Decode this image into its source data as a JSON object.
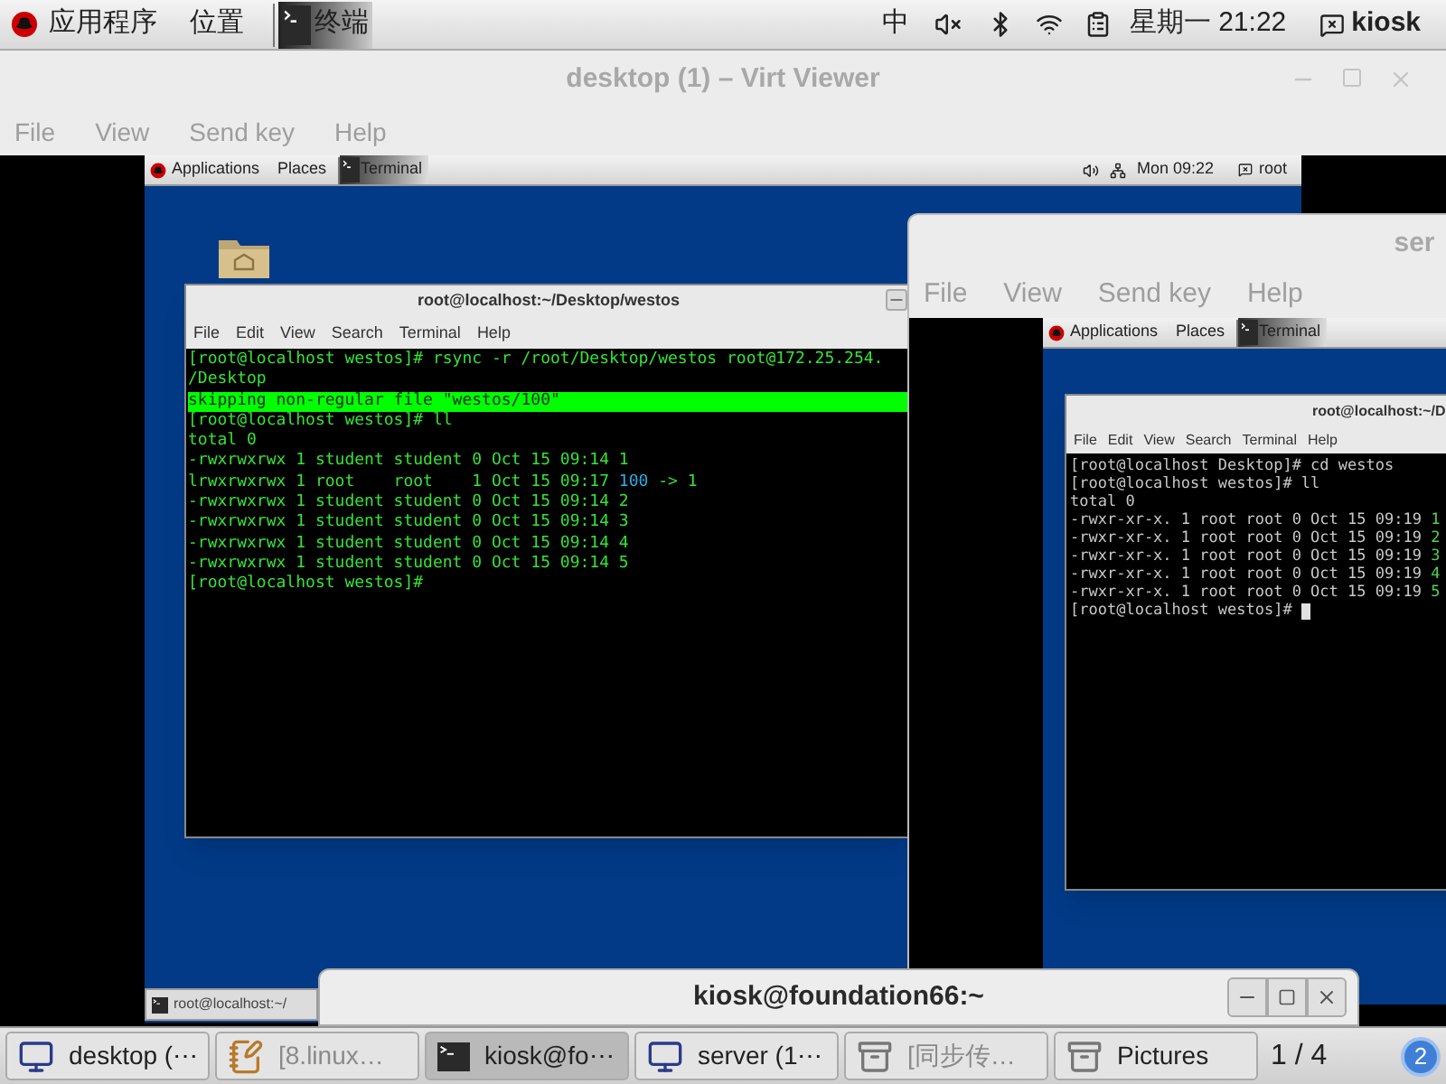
{
  "top_panel": {
    "menus": [
      "应用程序",
      "位置"
    ],
    "task": "终端",
    "input_method": "中",
    "clock": "星期一 21:22",
    "user": "kiosk"
  },
  "viewers": [
    {
      "title": "desktop (1) – Virt Viewer",
      "menus": [
        "File",
        "View",
        "Send key",
        "Help"
      ],
      "guest": {
        "panel": {
          "menus": [
            "Applications",
            "Places"
          ],
          "task": "Terminal",
          "clock": "Mon 09:22",
          "user": "root"
        },
        "home_folder": true,
        "terminal": {
          "title": "root@localhost:~/Desktop/westos",
          "menus": [
            "File",
            "Edit",
            "View",
            "Search",
            "Terminal",
            "Help"
          ],
          "cursor": false,
          "lines": [
            {
              "kind": "plain",
              "segments": [
                {
                  "text": "[root@localhost westos]# rsync -r /root/Desktop/westos root@172.25.254.",
                  "color": "#35e335"
                }
              ]
            },
            {
              "kind": "plain",
              "segments": [
                {
                  "text": "/Desktop",
                  "color": "#35e335"
                }
              ]
            },
            {
              "kind": "highlight",
              "segments": [
                {
                  "text": "skipping non-regular file \"westos/100\""
                }
              ]
            },
            {
              "kind": "plain",
              "segments": [
                {
                  "text": "[root@localhost westos]# ll",
                  "color": "#35e335"
                }
              ]
            },
            {
              "kind": "plain",
              "segments": [
                {
                  "text": "total 0",
                  "color": "#35e335"
                }
              ]
            },
            {
              "kind": "plain",
              "segments": [
                {
                  "text": "-rwxrwxrwx 1 student student 0 Oct 15 09:14 1",
                  "color": "#35e335"
                }
              ]
            },
            {
              "kind": "plain",
              "segments": [
                {
                  "text": "lrwxrwxrwx 1 root    root    1 Oct 15 09:17 ",
                  "color": "#35e335"
                },
                {
                  "text": "100",
                  "color": "#2ab0e6"
                },
                {
                  "text": " -> 1",
                  "color": "#35e335"
                }
              ]
            },
            {
              "kind": "plain",
              "segments": [
                {
                  "text": "-rwxrwxrwx 1 student student 0 Oct 15 09:14 2",
                  "color": "#35e335"
                }
              ]
            },
            {
              "kind": "plain",
              "segments": [
                {
                  "text": "-rwxrwxrwx 1 student student 0 Oct 15 09:14 3",
                  "color": "#35e335"
                }
              ]
            },
            {
              "kind": "plain",
              "segments": [
                {
                  "text": "-rwxrwxrwx 1 student student 0 Oct 15 09:14 4",
                  "color": "#35e335"
                }
              ]
            },
            {
              "kind": "plain",
              "segments": [
                {
                  "text": "-rwxrwxrwx 1 student student 0 Oct 15 09:14 5",
                  "color": "#35e335"
                }
              ]
            },
            {
              "kind": "plain",
              "segments": [
                {
                  "text": "[root@localhost westos]#",
                  "color": "#35e335"
                }
              ]
            }
          ]
        },
        "taskbar": [
          "root@localhost:~/"
        ]
      }
    },
    {
      "title": "ser",
      "menus": [
        "File",
        "View",
        "Send key",
        "Help"
      ],
      "guest": {
        "panel": {
          "menus": [
            "Applications",
            "Places"
          ],
          "task": "Terminal"
        },
        "home_folder": false,
        "terminal": {
          "title": "root@localhost:~/D",
          "menus": [
            "File",
            "Edit",
            "View",
            "Search",
            "Terminal",
            "Help"
          ],
          "cursor": true,
          "lines": [
            {
              "kind": "plain",
              "segments": [
                {
                  "text": "[root@localhost Desktop]# cd westos",
                  "color": "#c8c8c8"
                }
              ]
            },
            {
              "kind": "plain",
              "segments": [
                {
                  "text": "[root@localhost westos]# ll",
                  "color": "#c8c8c8"
                }
              ]
            },
            {
              "kind": "plain",
              "segments": [
                {
                  "text": "total 0",
                  "color": "#c8c8c8"
                }
              ]
            },
            {
              "kind": "plain",
              "segments": [
                {
                  "text": "-rwxr-xr-x. 1 root root 0 Oct 15 09:19 ",
                  "color": "#c8c8c8"
                },
                {
                  "text": "1",
                  "color": "#4fd24f"
                }
              ]
            },
            {
              "kind": "plain",
              "segments": [
                {
                  "text": "-rwxr-xr-x. 1 root root 0 Oct 15 09:19 ",
                  "color": "#c8c8c8"
                },
                {
                  "text": "2",
                  "color": "#4fd24f"
                }
              ]
            },
            {
              "kind": "plain",
              "segments": [
                {
                  "text": "-rwxr-xr-x. 1 root root 0 Oct 15 09:19 ",
                  "color": "#c8c8c8"
                },
                {
                  "text": "3",
                  "color": "#4fd24f"
                }
              ]
            },
            {
              "kind": "plain",
              "segments": [
                {
                  "text": "-rwxr-xr-x. 1 root root 0 Oct 15 09:19 ",
                  "color": "#c8c8c8"
                },
                {
                  "text": "4",
                  "color": "#4fd24f"
                }
              ]
            },
            {
              "kind": "plain",
              "segments": [
                {
                  "text": "-rwxr-xr-x. 1 root root 0 Oct 15 09:19 ",
                  "color": "#c8c8c8"
                },
                {
                  "text": "5",
                  "color": "#4fd24f"
                }
              ]
            },
            {
              "kind": "plain",
              "segments": [
                {
                  "text": "[root@localhost westos]# ",
                  "color": "#c8c8c8"
                }
              ]
            }
          ]
        }
      }
    }
  ],
  "kiosk_window": {
    "title": "kiosk@foundation66:~"
  },
  "taskbar": {
    "items": [
      {
        "label": "desktop (⋯",
        "kind": "monitor",
        "selected": false,
        "minimized": false
      },
      {
        "label": "[8.linux…",
        "kind": "notepad",
        "selected": false,
        "minimized": true
      },
      {
        "label": "kiosk@fo⋯",
        "kind": "terminal",
        "selected": true,
        "minimized": false
      },
      {
        "label": "server (1⋯",
        "kind": "monitor",
        "selected": false,
        "minimized": false
      },
      {
        "label": "[同步传…",
        "kind": "cabinet",
        "selected": false,
        "minimized": true
      },
      {
        "label": "Pictures",
        "kind": "cabinet",
        "selected": false,
        "minimized": false
      }
    ],
    "workspace": "1 / 4",
    "badge": "2"
  }
}
